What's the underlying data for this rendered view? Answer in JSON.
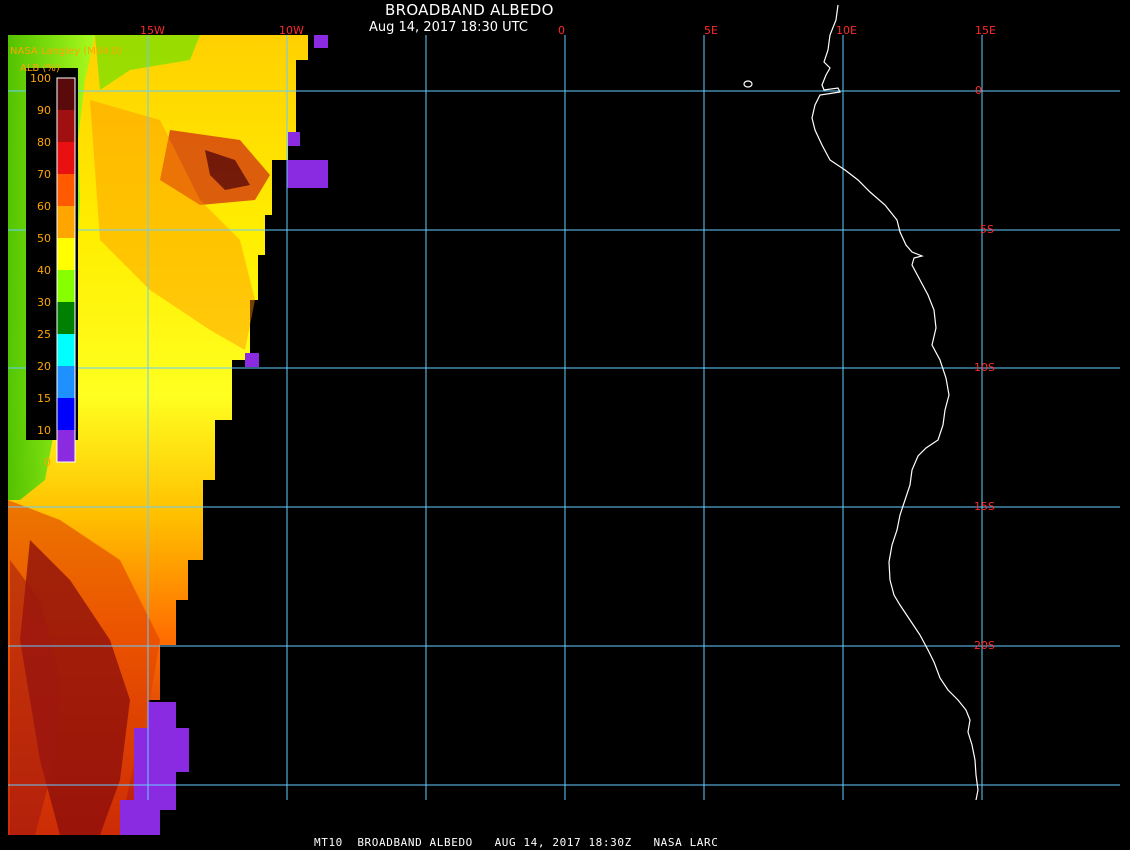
{
  "title": "BROADBAND ALBEDO",
  "subtitle": "Aug 14, 2017 18:30 UTC",
  "source": "NASA Langley (M04.0)",
  "footer": "MT10  BROADBAND ALBEDO   AUG 14, 2017 18:30Z   NASA LARC",
  "colorbar": {
    "title": "ALB (%)",
    "ticks": [
      "100",
      "90",
      "80",
      "70",
      "60",
      "50",
      "40",
      "30",
      "25",
      "20",
      "15",
      "10",
      "0"
    ],
    "colors": [
      "#5a0a0a",
      "#a01010",
      "#e81010",
      "#ff5a00",
      "#ffa500",
      "#ffff00",
      "#88ff00",
      "#008000",
      "#00ffff",
      "#1e90ff",
      "#0000ff",
      "#8a2be2"
    ]
  },
  "grid": {
    "longitudes": [
      "15W",
      "10W",
      "0",
      "5E",
      "10E",
      "15E"
    ],
    "latitudes": [
      "0",
      "5S",
      "10S",
      "15S",
      "20S"
    ]
  },
  "colors": {
    "grid": "#66ccff",
    "coast": "#ffffff",
    "labels": "#ff2a2a",
    "background": "#000000"
  }
}
